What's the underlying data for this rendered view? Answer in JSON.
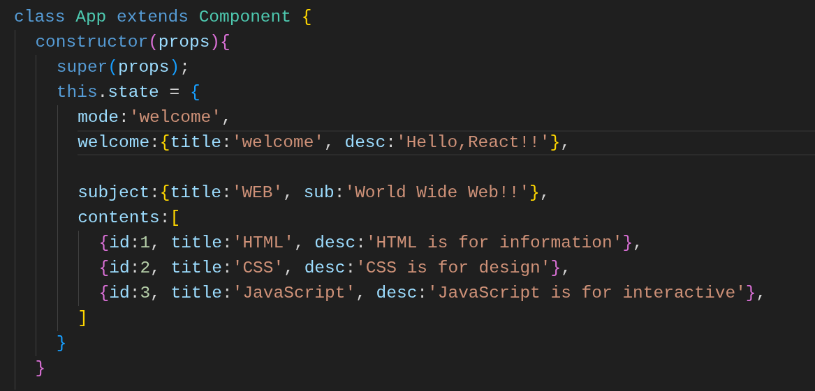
{
  "editor": {
    "lines": [
      {
        "highlighted": false,
        "tokens": [
          {
            "kind": "keyword",
            "text": "class "
          },
          {
            "kind": "type",
            "text": "App "
          },
          {
            "kind": "keyword",
            "text": "extends "
          },
          {
            "kind": "type",
            "text": "Component "
          },
          {
            "kind": "bracket",
            "text": "{",
            "color": "#ffd700"
          }
        ],
        "children": [
          {
            "highlighted": false,
            "tokens": [
              {
                "kind": "keyword",
                "text": "constructor"
              },
              {
                "kind": "bracket",
                "text": "(",
                "color": "#da70d6"
              },
              {
                "kind": "variable",
                "text": "props"
              },
              {
                "kind": "bracket",
                "text": ")",
                "color": "#da70d6"
              },
              {
                "kind": "bracket",
                "text": "{",
                "color": "#da70d6"
              }
            ],
            "children": [
              {
                "highlighted": false,
                "tokens": [
                  {
                    "kind": "keyword",
                    "text": "super"
                  },
                  {
                    "kind": "bracket",
                    "text": "(",
                    "color": "#179fff"
                  },
                  {
                    "kind": "variable",
                    "text": "props"
                  },
                  {
                    "kind": "bracket",
                    "text": ")",
                    "color": "#179fff"
                  },
                  {
                    "kind": "plain",
                    "text": ";"
                  }
                ]
              },
              {
                "highlighted": false,
                "tokens": [
                  {
                    "kind": "keyword",
                    "text": "this"
                  },
                  {
                    "kind": "plain",
                    "text": "."
                  },
                  {
                    "kind": "variable",
                    "text": "state"
                  },
                  {
                    "kind": "plain",
                    "text": " = "
                  },
                  {
                    "kind": "bracket",
                    "text": "{",
                    "color": "#179fff"
                  }
                ],
                "children": [
                  {
                    "highlighted": false,
                    "tokens": [
                      {
                        "kind": "variable",
                        "text": "mode"
                      },
                      {
                        "kind": "plain",
                        "text": ":"
                      },
                      {
                        "kind": "string",
                        "text": "'welcome'"
                      },
                      {
                        "kind": "plain",
                        "text": ","
                      }
                    ]
                  },
                  {
                    "highlighted": true,
                    "tokens": [
                      {
                        "kind": "variable",
                        "text": "welcome"
                      },
                      {
                        "kind": "plain",
                        "text": ":"
                      },
                      {
                        "kind": "bracket",
                        "text": "{",
                        "color": "#ffd700"
                      },
                      {
                        "kind": "variable",
                        "text": "title"
                      },
                      {
                        "kind": "plain",
                        "text": ":"
                      },
                      {
                        "kind": "string",
                        "text": "'welcome'"
                      },
                      {
                        "kind": "plain",
                        "text": ", "
                      },
                      {
                        "kind": "variable",
                        "text": "desc"
                      },
                      {
                        "kind": "plain",
                        "text": ":"
                      },
                      {
                        "kind": "string",
                        "text": "'Hello,React!!'"
                      },
                      {
                        "kind": "bracket",
                        "text": "}",
                        "color": "#ffd700"
                      },
                      {
                        "kind": "plain",
                        "text": ","
                      }
                    ]
                  },
                  {
                    "highlighted": false
                  },
                  {
                    "highlighted": false,
                    "tokens": [
                      {
                        "kind": "variable",
                        "text": "subject"
                      },
                      {
                        "kind": "plain",
                        "text": ":"
                      },
                      {
                        "kind": "bracket",
                        "text": "{",
                        "color": "#ffd700"
                      },
                      {
                        "kind": "variable",
                        "text": "title"
                      },
                      {
                        "kind": "plain",
                        "text": ":"
                      },
                      {
                        "kind": "string",
                        "text": "'WEB'"
                      },
                      {
                        "kind": "plain",
                        "text": ", "
                      },
                      {
                        "kind": "variable",
                        "text": "sub"
                      },
                      {
                        "kind": "plain",
                        "text": ":"
                      },
                      {
                        "kind": "string",
                        "text": "'World Wide Web!!'"
                      },
                      {
                        "kind": "bracket",
                        "text": "}",
                        "color": "#ffd700"
                      },
                      {
                        "kind": "plain",
                        "text": ","
                      }
                    ]
                  },
                  {
                    "highlighted": false,
                    "tokens": [
                      {
                        "kind": "variable",
                        "text": "contents"
                      },
                      {
                        "kind": "plain",
                        "text": ":"
                      },
                      {
                        "kind": "bracket",
                        "text": "[",
                        "color": "#ffd700"
                      }
                    ],
                    "children": [
                      {
                        "highlighted": false,
                        "tokens": [
                          {
                            "kind": "bracket",
                            "text": "{",
                            "color": "#da70d6"
                          },
                          {
                            "kind": "variable",
                            "text": "id"
                          },
                          {
                            "kind": "plain",
                            "text": ":"
                          },
                          {
                            "kind": "number",
                            "text": "1"
                          },
                          {
                            "kind": "plain",
                            "text": ", "
                          },
                          {
                            "kind": "variable",
                            "text": "title"
                          },
                          {
                            "kind": "plain",
                            "text": ":"
                          },
                          {
                            "kind": "string",
                            "text": "'HTML'"
                          },
                          {
                            "kind": "plain",
                            "text": ", "
                          },
                          {
                            "kind": "variable",
                            "text": "desc"
                          },
                          {
                            "kind": "plain",
                            "text": ":"
                          },
                          {
                            "kind": "string",
                            "text": "'HTML is for information'"
                          },
                          {
                            "kind": "bracket",
                            "text": "}",
                            "color": "#da70d6"
                          },
                          {
                            "kind": "plain",
                            "text": ","
                          }
                        ]
                      },
                      {
                        "highlighted": false,
                        "tokens": [
                          {
                            "kind": "bracket",
                            "text": "{",
                            "color": "#da70d6"
                          },
                          {
                            "kind": "variable",
                            "text": "id"
                          },
                          {
                            "kind": "plain",
                            "text": ":"
                          },
                          {
                            "kind": "number",
                            "text": "2"
                          },
                          {
                            "kind": "plain",
                            "text": ", "
                          },
                          {
                            "kind": "variable",
                            "text": "title"
                          },
                          {
                            "kind": "plain",
                            "text": ":"
                          },
                          {
                            "kind": "string",
                            "text": "'CSS'"
                          },
                          {
                            "kind": "plain",
                            "text": ", "
                          },
                          {
                            "kind": "variable",
                            "text": "desc"
                          },
                          {
                            "kind": "plain",
                            "text": ":"
                          },
                          {
                            "kind": "string",
                            "text": "'CSS is for design'"
                          },
                          {
                            "kind": "bracket",
                            "text": "}",
                            "color": "#da70d6"
                          },
                          {
                            "kind": "plain",
                            "text": ","
                          }
                        ]
                      },
                      {
                        "highlighted": false,
                        "tokens": [
                          {
                            "kind": "bracket",
                            "text": "{",
                            "color": "#da70d6"
                          },
                          {
                            "kind": "variable",
                            "text": "id"
                          },
                          {
                            "kind": "plain",
                            "text": ":"
                          },
                          {
                            "kind": "number",
                            "text": "3"
                          },
                          {
                            "kind": "plain",
                            "text": ", "
                          },
                          {
                            "kind": "variable",
                            "text": "title"
                          },
                          {
                            "kind": "plain",
                            "text": ":"
                          },
                          {
                            "kind": "string",
                            "text": "'JavaScript'"
                          },
                          {
                            "kind": "plain",
                            "text": ", "
                          },
                          {
                            "kind": "variable",
                            "text": "desc"
                          },
                          {
                            "kind": "plain",
                            "text": ":"
                          },
                          {
                            "kind": "string",
                            "text": "'JavaScript is for interactive'"
                          },
                          {
                            "kind": "bracket",
                            "text": "}",
                            "color": "#da70d6"
                          },
                          {
                            "kind": "plain",
                            "text": ","
                          }
                        ]
                      }
                    ]
                  },
                  {
                    "highlighted": false,
                    "tokens": [
                      {
                        "kind": "bracket",
                        "text": "]",
                        "color": "#ffd700"
                      }
                    ]
                  }
                ]
              },
              {
                "highlighted": false,
                "tokens": [
                  {
                    "kind": "bracket",
                    "text": "}",
                    "color": "#179fff"
                  }
                ]
              }
            ]
          },
          {
            "highlighted": false,
            "tokens": [
              {
                "kind": "bracket",
                "text": "}",
                "color": "#da70d6"
              }
            ]
          }
        ]
      }
    ]
  }
}
